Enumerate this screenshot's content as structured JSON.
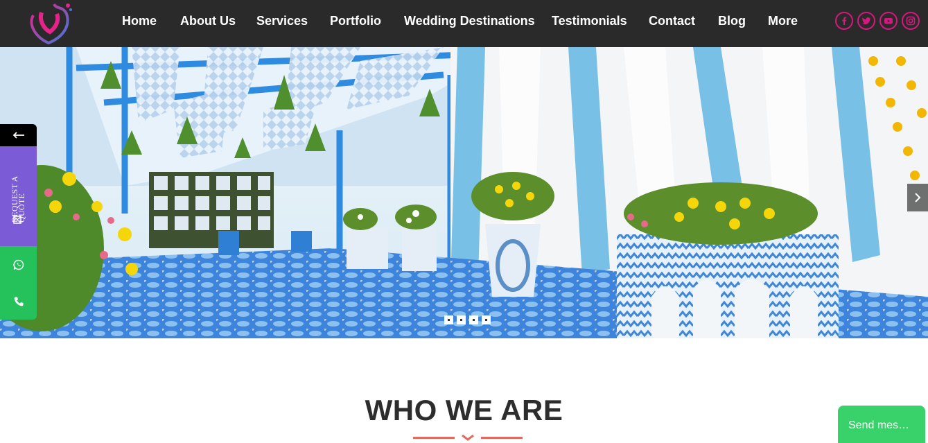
{
  "nav": {
    "items": [
      {
        "label": "Home"
      },
      {
        "label": "About Us"
      },
      {
        "label": "Services"
      },
      {
        "label": "Portfolio"
      },
      {
        "label": "Wedding Destinations"
      },
      {
        "label": "Testimonials"
      },
      {
        "label": "Contact"
      },
      {
        "label": "Blog"
      },
      {
        "label": "More"
      }
    ]
  },
  "social": {
    "accent_color": "#d6187f",
    "icons": [
      "facebook-icon",
      "twitter-icon",
      "youtube-icon",
      "instagram-icon"
    ]
  },
  "hero": {
    "slide_count": 4,
    "next_icon": "chevron-right-icon"
  },
  "sidebar": {
    "back_icon": "arrow-left-icon",
    "quote_label": "REQUEST A QUOTE",
    "quote_color": "#7b5bd6",
    "whatsapp_icon": "whatsapp-icon",
    "phone_icon": "phone-icon",
    "contact_color": "#25c25c"
  },
  "section": {
    "title": "WHO WE ARE",
    "divider_color": "#e46a5f"
  },
  "chat": {
    "label": "Send mes…"
  }
}
